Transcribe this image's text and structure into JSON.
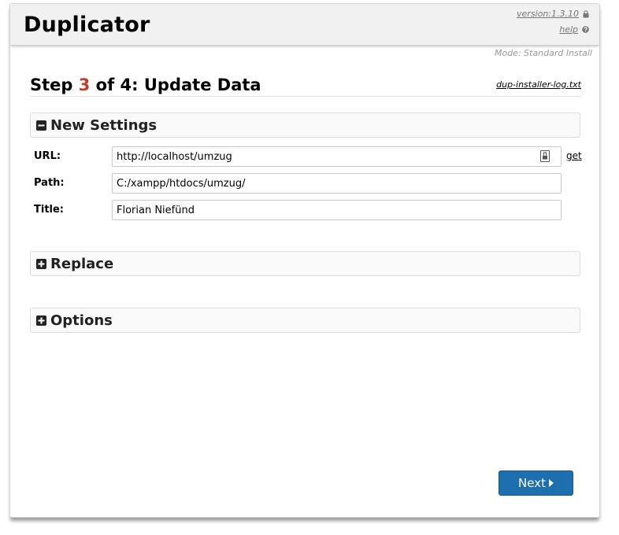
{
  "header": {
    "app_title": "Duplicator",
    "version_label": "version:1.3.10",
    "help_label": "help"
  },
  "mode_label": "Mode: Standard Install",
  "step": {
    "prefix": "Step ",
    "number": "3",
    "suffix": " of 4: Update Data",
    "log_link": "dup-installer-log.txt"
  },
  "sections": {
    "new_settings": {
      "label": "New Settings",
      "expanded": true,
      "icon": "minus-square-icon"
    },
    "replace": {
      "label": "Replace",
      "expanded": false,
      "icon": "plus-square-icon"
    },
    "options": {
      "label": "Options",
      "expanded": false,
      "icon": "plus-square-icon"
    }
  },
  "fields": {
    "url": {
      "label": "URL:",
      "value": "http://localhost/umzug"
    },
    "path": {
      "label": "Path:",
      "value": "C:/xampp/htdocs/umzug/"
    },
    "title": {
      "label": "Title:",
      "value": "Florian Niefünd"
    }
  },
  "get_link": "get",
  "next_button": {
    "label": "Next",
    "icon": "caret-right-icon"
  },
  "colors": {
    "accent_red": "#c53a2a",
    "button_blue": "#1e6fae",
    "header_bg": "#f1f1f1"
  }
}
